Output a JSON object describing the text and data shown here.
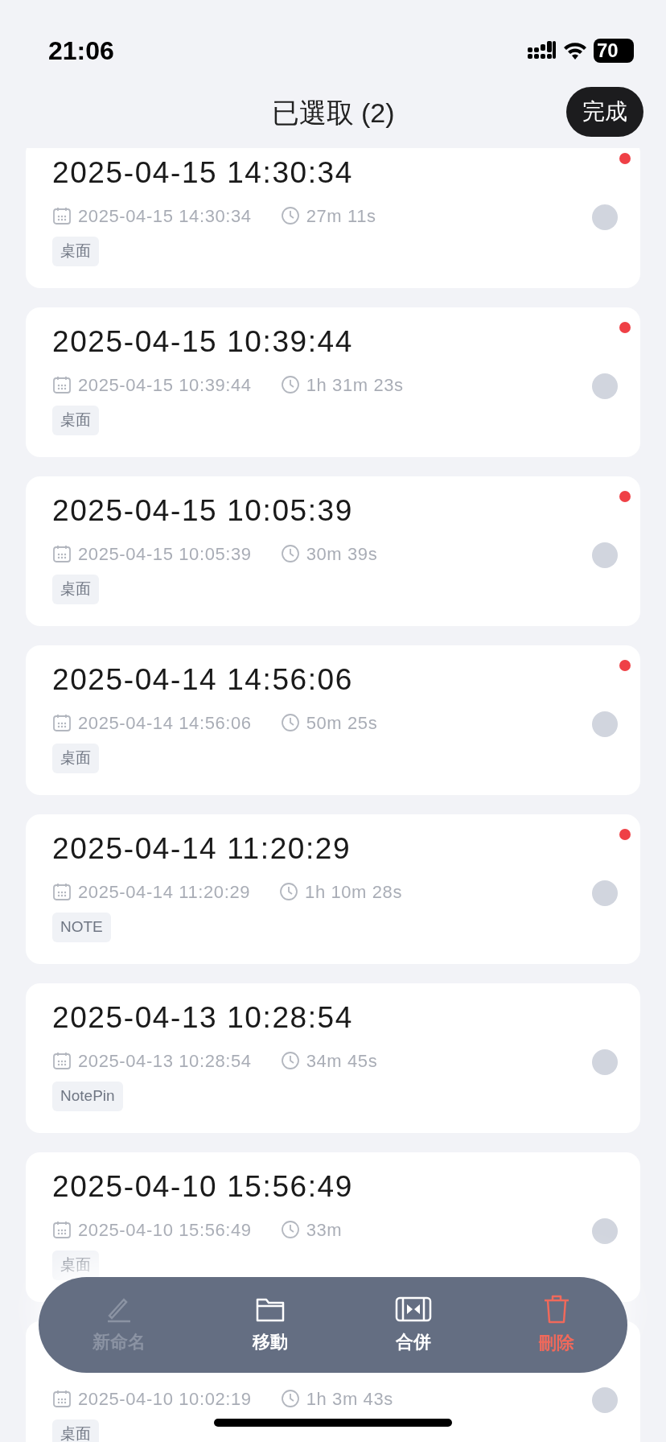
{
  "status_bar": {
    "time": "21:06",
    "battery": "70"
  },
  "header": {
    "title": "已選取 (2)",
    "done_button": "完成"
  },
  "recordings": [
    {
      "title": "2025-04-15 14:30:34",
      "date": "2025-04-15 14:30:34",
      "duration": "27m 11s",
      "tag": "桌面",
      "unread": true,
      "selected": false
    },
    {
      "title": "2025-04-15 10:39:44",
      "date": "2025-04-15 10:39:44",
      "duration": "1h 31m 23s",
      "tag": "桌面",
      "unread": true,
      "selected": false
    },
    {
      "title": "2025-04-15 10:05:39",
      "date": "2025-04-15 10:05:39",
      "duration": "30m 39s",
      "tag": "桌面",
      "unread": true,
      "selected": false
    },
    {
      "title": "2025-04-14 14:56:06",
      "date": "2025-04-14 14:56:06",
      "duration": "50m 25s",
      "tag": "桌面",
      "unread": true,
      "selected": false
    },
    {
      "title": "2025-04-14 11:20:29",
      "date": "2025-04-14 11:20:29",
      "duration": "1h 10m 28s",
      "tag": "NOTE",
      "unread": true,
      "selected": false
    },
    {
      "title": "2025-04-13 10:28:54",
      "date": "2025-04-13 10:28:54",
      "duration": "34m 45s",
      "tag": "NotePin",
      "unread": false,
      "selected": false
    },
    {
      "title": "2025-04-10 15:56:49",
      "date": "2025-04-10 15:56:49",
      "duration": "33m",
      "tag": "桌面",
      "unread": false,
      "selected": false
    },
    {
      "date": "2025-04-10 10:02:19",
      "duration": "1h 3m 43s",
      "tag": "桌面",
      "unread": false,
      "selected": false
    }
  ],
  "action_bar": [
    {
      "kind": "rename",
      "label": "新命名",
      "disabled": true
    },
    {
      "kind": "move",
      "label": "移動",
      "disabled": false
    },
    {
      "kind": "merge",
      "label": "合併",
      "disabled": false
    },
    {
      "kind": "delete",
      "label": "刪除",
      "disabled": false
    }
  ]
}
